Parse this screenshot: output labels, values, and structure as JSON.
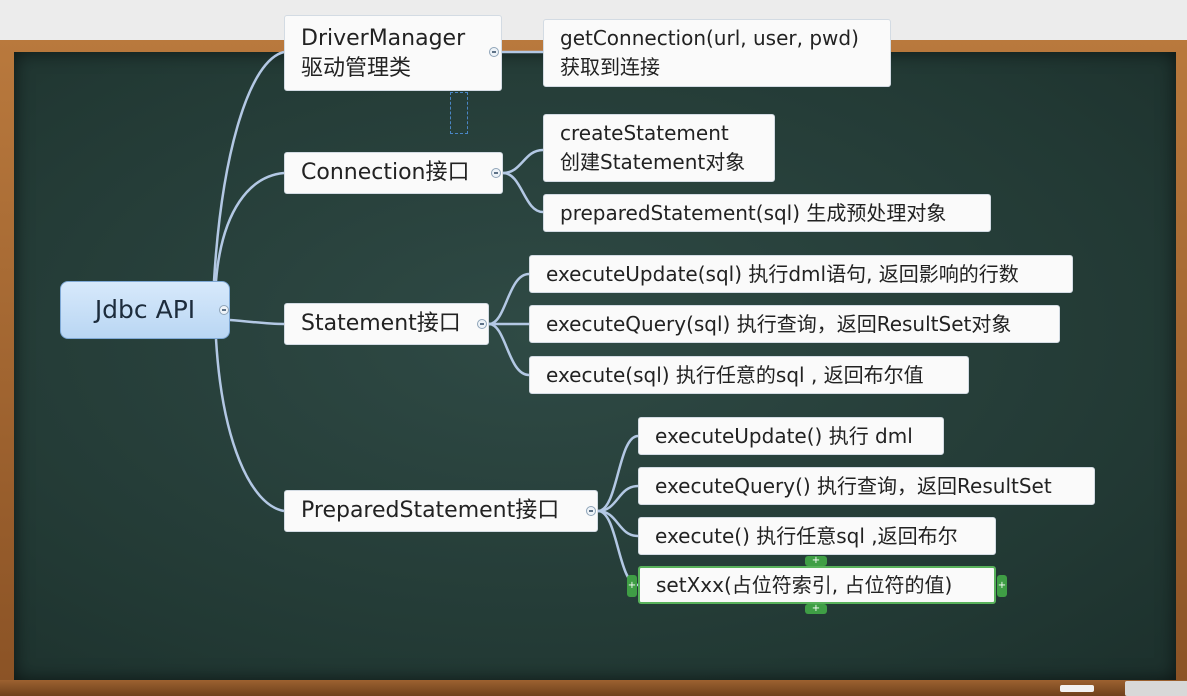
{
  "root": {
    "label": "Jdbc API"
  },
  "branches": {
    "driver_manager": {
      "label_line1": "DriverManager",
      "label_line2": "驱动管理类",
      "children": [
        {
          "line1": "getConnection(url, user, pwd)",
          "line2": "获取到连接"
        }
      ]
    },
    "connection": {
      "label": "Connection接口",
      "children": [
        {
          "line1": "createStatement",
          "line2": "创建Statement对象"
        },
        {
          "line1": "preparedStatement(sql) 生成预处理对象"
        }
      ]
    },
    "statement": {
      "label": "Statement接口",
      "children": [
        {
          "line1": "executeUpdate(sql) 执行dml语句, 返回影响的行数"
        },
        {
          "line1": "executeQuery(sql) 执行查询，返回ResultSet对象"
        },
        {
          "line1": "execute(sql) 执行任意的sql , 返回布尔值"
        }
      ]
    },
    "prepared_statement": {
      "label": "PreparedStatement接口",
      "children": [
        {
          "line1": "executeUpdate() 执行 dml"
        },
        {
          "line1": "executeQuery() 执行查询，返回ResultSet"
        },
        {
          "line1": "execute() 执行任意sql ,返回布尔"
        },
        {
          "line1": "setXxx(占位符索引, 占位符的值)"
        }
      ]
    }
  },
  "colors": {
    "board": "#263f3a",
    "frame": "#a66a33",
    "connector": "#b3c8e4",
    "root_fill": "#c7def6",
    "selected_border": "#58b25b"
  },
  "icons": {
    "collapse": "collapse-toggle-icon",
    "add": "add-topic-icon"
  }
}
